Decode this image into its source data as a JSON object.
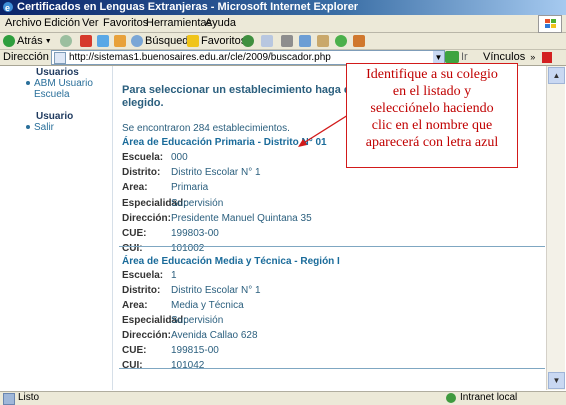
{
  "window": {
    "title": "Certificados en Lenguas Extranjeras - Microsoft Internet Explorer"
  },
  "menu": [
    "Archivo",
    "Edición",
    "Ver",
    "Favoritos",
    "Herramientas",
    "Ayuda"
  ],
  "toolbar": {
    "back_label": "Atrás",
    "search_label": "Búsqueda",
    "favorites_label": "Favoritos"
  },
  "address": {
    "label": "Dirección",
    "url": "http://sistemas1.buenosaires.edu.ar/cle/2009/buscador.php",
    "go_label": "Ir",
    "links_label": "Vínculos"
  },
  "sidebar": {
    "section1_title": "Usuarios",
    "section1_items": [
      "ABM Usuario",
      "Escuela"
    ],
    "section2_title": "Usuario",
    "section2_items": [
      "Salir"
    ]
  },
  "main": {
    "heading_line1": "Para seleccionar un establecimiento haga clic",
    "heading_line2": "elegido.",
    "found_text": "Se encontraron 284 establecimientos.",
    "labels": {
      "escuela": "Escuela:",
      "distrito": "Distrito:",
      "area": "Area:",
      "especialidad": "Especialidad:",
      "direccion": "Dirección:",
      "cue": "CUE:",
      "cui": "CUI:"
    },
    "records": [
      {
        "area_title": "Área de Educación Primaria - Distrito N° 01",
        "escuela": "000",
        "distrito": "Distrito Escolar N° 1",
        "area": "Primaria",
        "especialidad": "Supervisión",
        "direccion": "Presidente Manuel Quintana 35",
        "cue": "199803-00",
        "cui": "101002"
      },
      {
        "area_title": "Área de Educación Media y Técnica - Región I",
        "escuela": "1",
        "distrito": "Distrito Escolar N° 1",
        "area": "Media y Técnica",
        "especialidad": "Supervisión",
        "direccion": "Avenida Callao 628",
        "cue": "199815-00",
        "cui": "101042"
      }
    ]
  },
  "callout": {
    "lines": [
      "Identifique a su  colegio",
      "en el listado y",
      "selecciónelo haciendo",
      "clic en el nombre que",
      "aparecerá con letra azul"
    ]
  },
  "status": {
    "left": "Listo",
    "zone": "Intranet local"
  },
  "colors": {
    "titlebar": "#0a246a",
    "link": "#1a6b9a",
    "callout_border": "#d21a1a",
    "callout_text": "#c00000"
  }
}
